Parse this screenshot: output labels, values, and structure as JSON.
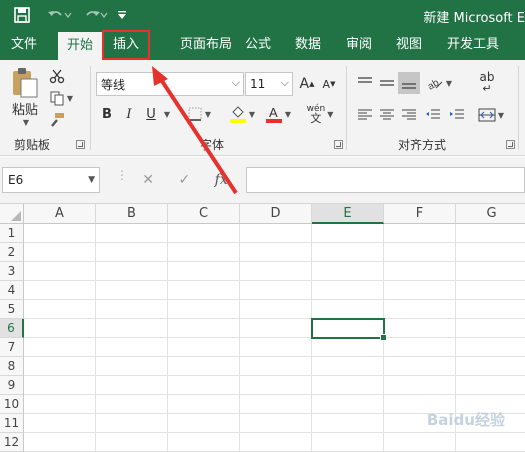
{
  "window": {
    "title": "新建 Microsoft E"
  },
  "quick_access": {
    "save_icon": "save-icon",
    "undo_icon": "undo-icon",
    "redo_icon": "redo-icon",
    "customize_icon": "customize-qat-icon"
  },
  "tabs": [
    {
      "label": "文件"
    },
    {
      "label": "开始"
    },
    {
      "label": "插入"
    },
    {
      "label": "页面布局"
    },
    {
      "label": "公式"
    },
    {
      "label": "数据"
    },
    {
      "label": "审阅"
    },
    {
      "label": "视图"
    },
    {
      "label": "开发工具"
    }
  ],
  "active_tab": "开始",
  "highlighted_tab": "插入",
  "ribbon": {
    "clipboard": {
      "paste_label": "粘贴",
      "group_label": "剪贴板"
    },
    "font": {
      "name": "等线",
      "size": "11",
      "group_label": "字体",
      "bold": "B",
      "italic": "I",
      "underline": "U",
      "phonetic": "wén",
      "grow": "A",
      "shrink": "A"
    },
    "alignment": {
      "group_label": "对齐方式",
      "wrap": "ab"
    }
  },
  "formula_bar": {
    "name_box": "E6",
    "fx": "fx",
    "value": ""
  },
  "sheet": {
    "columns": [
      "A",
      "B",
      "C",
      "D",
      "E",
      "F",
      "G"
    ],
    "rows": [
      "1",
      "2",
      "3",
      "4",
      "5",
      "6",
      "7",
      "8",
      "9",
      "10",
      "11",
      "12"
    ],
    "selected_column": "E",
    "selected_row": "6"
  },
  "colors": {
    "accent": "#217346",
    "annotation": "#e5322d"
  },
  "watermark": "Baidu经验"
}
